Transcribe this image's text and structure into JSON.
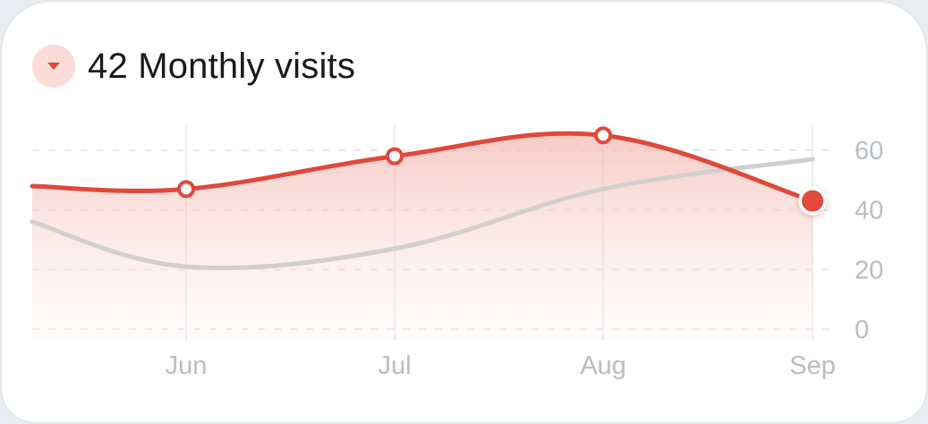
{
  "header": {
    "title": "42 Monthly visits",
    "trend": "down",
    "trend_icon": "caret-down-icon"
  },
  "colors": {
    "primary": "#e0483b",
    "secondary": "#d4cfcf",
    "badge_bg": "#fbdcd8",
    "grid": "#e8e8ea",
    "tick": "#b9bec5"
  },
  "chart_data": {
    "type": "area",
    "categories": [
      "Jun",
      "Jul",
      "Aug",
      "Sep"
    ],
    "series": [
      {
        "values": [
          48,
          47,
          58,
          65,
          43
        ]
      },
      {
        "values": [
          36,
          21,
          27,
          47,
          57
        ]
      }
    ],
    "y_ticks": [
      0,
      20,
      40,
      60
    ],
    "ylim": [
      0,
      60
    ],
    "grid": true,
    "y_axis_position": "right"
  }
}
